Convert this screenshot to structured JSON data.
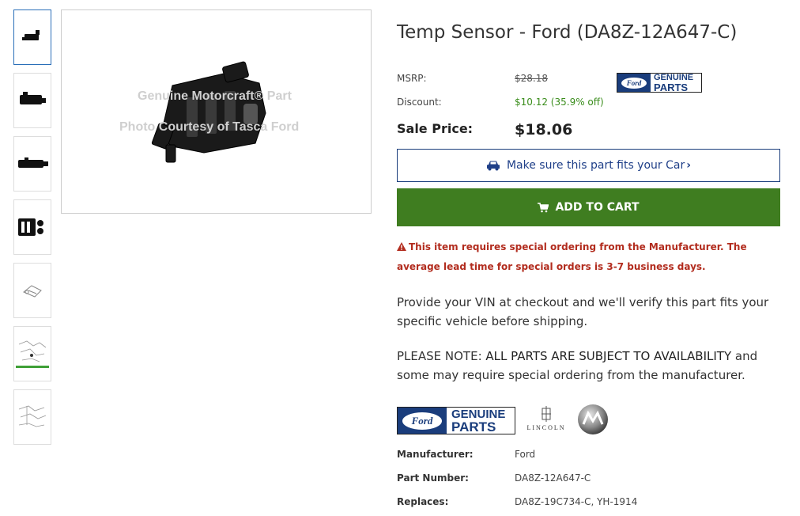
{
  "product": {
    "title": "Temp Sensor - Ford (DA8Z-12A647-C)",
    "msrp_label": "MSRP:",
    "msrp_value": "$28.18",
    "discount_label": "Discount:",
    "discount_value": "$10.12 (35.9% off)",
    "sale_label": "Sale Price:",
    "sale_value": "$18.06"
  },
  "image": {
    "watermark_line1": "Genuine Motorcraft® Part",
    "watermark_line2": "Photo Courtesy of Tasca Ford"
  },
  "thumbnails": [
    {
      "name": "thumb-1",
      "active": true
    },
    {
      "name": "thumb-2",
      "active": false
    },
    {
      "name": "thumb-3",
      "active": false
    },
    {
      "name": "thumb-4",
      "active": false
    },
    {
      "name": "thumb-5",
      "active": false
    },
    {
      "name": "thumb-6",
      "active": false
    },
    {
      "name": "thumb-7",
      "active": false
    }
  ],
  "brand_logo": {
    "oval_text": "Ford",
    "genuine": "GENUINE",
    "parts": "PARTS",
    "lincoln": "LINCOLN"
  },
  "fit_button": {
    "label": "Make sure this part fits your Car",
    "chevron": "›",
    "icon": "car-icon"
  },
  "cart_button": {
    "label": "ADD TO CART",
    "icon": "cart-icon"
  },
  "warning": {
    "icon": "warning-icon",
    "text": "This item requires special ordering from the Manufacturer. The average lead time for special orders is 3-7 business days."
  },
  "paragraphs": {
    "vin": "Provide your VIN at checkout and we'll verify this part fits your specific vehicle before shipping.",
    "note_prefix": "PLEASE NOTE:",
    "note_caps": "ALL PARTS ARE SUBJECT TO AVAILABILITY",
    "note_rest": "and some may require special ordering from the manufacturer."
  },
  "specs": [
    {
      "label": "Manufacturer:",
      "value": "Ford"
    },
    {
      "label": "Part Number:",
      "value": "DA8Z-12A647-C"
    },
    {
      "label": "Replaces:",
      "value": "DA8Z-19C734-C, YH-1914"
    }
  ],
  "colors": {
    "cart_green": "#3f7d20",
    "discount_green": "#3a8d1c",
    "warning_red": "#b22c1e",
    "ford_blue": "#1a3d7c"
  }
}
